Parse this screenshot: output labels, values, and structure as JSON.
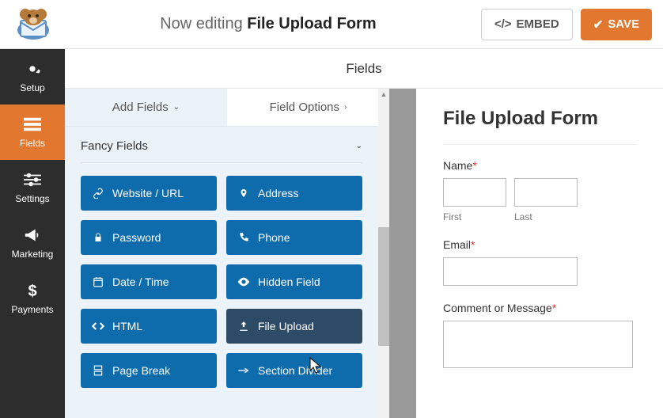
{
  "header": {
    "editing_prefix": "Now editing ",
    "form_name": "File Upload Form",
    "embed": "EMBED",
    "save": "SAVE"
  },
  "sidebar": {
    "items": [
      {
        "label": "Setup"
      },
      {
        "label": "Fields"
      },
      {
        "label": "Settings"
      },
      {
        "label": "Marketing"
      },
      {
        "label": "Payments"
      }
    ]
  },
  "panel_title": "Fields",
  "tabs": {
    "add": "Add Fields",
    "options": "Field Options"
  },
  "group_title": "Fancy Fields",
  "fields": [
    {
      "label": "Website / URL",
      "icon": "link"
    },
    {
      "label": "Address",
      "icon": "pin"
    },
    {
      "label": "Password",
      "icon": "lock"
    },
    {
      "label": "Phone",
      "icon": "phone"
    },
    {
      "label": "Date / Time",
      "icon": "calendar"
    },
    {
      "label": "Hidden Field",
      "icon": "eye"
    },
    {
      "label": "HTML",
      "icon": "code"
    },
    {
      "label": "File Upload",
      "icon": "upload"
    },
    {
      "label": "Page Break",
      "icon": "pagebreak"
    },
    {
      "label": "Section Divider",
      "icon": "divider"
    }
  ],
  "preview": {
    "title": "File Upload Form",
    "name_label": "Name",
    "first": "First",
    "last": "Last",
    "email_label": "Email",
    "comment_label": "Comment or Message"
  }
}
